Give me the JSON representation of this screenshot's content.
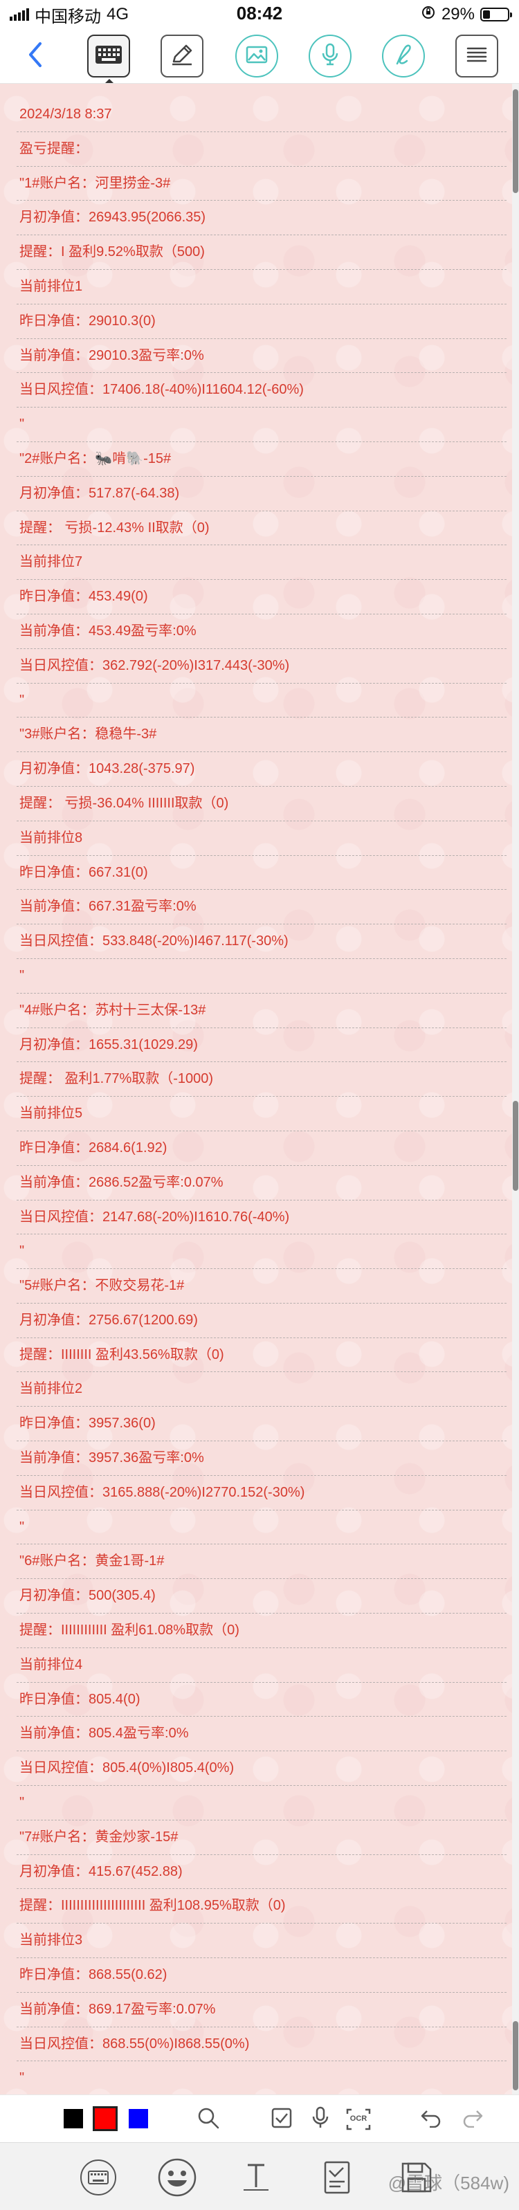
{
  "status_bar": {
    "carrier": "中国移动",
    "network": "4G",
    "time": "08:42",
    "battery": "29%",
    "battery_level": 0.29
  },
  "toolbar": {
    "icons": [
      "back-icon",
      "keyboard-icon",
      "pen-icon",
      "image-icon",
      "microphone-icon",
      "handwriting-icon",
      "menu-icon"
    ]
  },
  "note": {
    "lines": [
      "2024/3/18 8:37",
      "盈亏提醒：",
      "\"1#账户名：河里捞金-3#",
      "月初净值：26943.95(2066.35)",
      "提醒：I 盈利9.52%取款（500)",
      "当前排位1",
      "昨日净值：29010.3(0)",
      "当前净值：29010.3盈亏率:0%",
      "当日风控值：17406.18(-40%)I11604.12(-60%)",
      "\"",
      "\"2#账户名：🐜啃🐘-15#",
      "月初净值：517.87(-64.38)",
      "提醒：  亏损-12.43% II取款（0)",
      "当前排位7",
      "昨日净值：453.49(0)",
      "当前净值：453.49盈亏率:0%",
      "当日风控值：362.792(-20%)I317.443(-30%)",
      "\"",
      "\"3#账户名：稳稳牛-3#",
      "月初净值：1043.28(-375.97)",
      "提醒：  亏损-36.04% IIIIIII取款（0)",
      "当前排位8",
      "昨日净值：667.31(0)",
      "当前净值：667.31盈亏率:0%",
      "当日风控值：533.848(-20%)I467.117(-30%)",
      "\"",
      "\"4#账户名：苏村十三太保-13#",
      "月初净值：1655.31(1029.29)",
      "提醒：  盈利1.77%取款（-1000)",
      "当前排位5",
      "昨日净值：2684.6(1.92)",
      "当前净值：2686.52盈亏率:0.07%",
      "当日风控值：2147.68(-20%)I1610.76(-40%)",
      "\"",
      "\"5#账户名：不败交易花-1#",
      "月初净值：2756.67(1200.69)",
      "提醒：IIIIIIII 盈利43.56%取款（0)",
      "当前排位2",
      "昨日净值：3957.36(0)",
      "当前净值：3957.36盈亏率:0%",
      "当日风控值：3165.888(-20%)I2770.152(-30%)",
      "\"",
      "\"6#账户名：黄金1哥-1#",
      "月初净值：500(305.4)",
      "提醒：IIIIIIIIIIII 盈利61.08%取款（0)",
      "当前排位4",
      "昨日净值：805.4(0)",
      "当前净值：805.4盈亏率:0%",
      "当日风控值：805.4(0%)I805.4(0%)",
      "\"",
      "\"7#账户名：黄金炒家-15#",
      "月初净值：415.67(452.88)",
      "提醒：IIIIIIIIIIIIIIIIIIIIII 盈利108.95%取款（0)",
      "当前排位3",
      "昨日净值：868.55(0.62)",
      "当前净值：869.17盈亏率:0.07%",
      "当日风控值：868.55(0%)I868.55(0%)",
      "\""
    ]
  },
  "format_bar": {
    "colors": [
      "#000000",
      "#ff0000",
      "#0000ff"
    ],
    "selected_color": "#ff0000",
    "icons": [
      "search-icon",
      "checkbox-icon",
      "microphone-icon",
      "ocr-icon",
      "undo-icon",
      "redo-icon"
    ],
    "ocr_label": "OCR"
  },
  "bottom_bar": {
    "icons": [
      "keyboard-icon",
      "emoji-icon",
      "text-format-icon",
      "document-icon",
      "save-icon"
    ],
    "watermark": "@雪球（584w)"
  }
}
